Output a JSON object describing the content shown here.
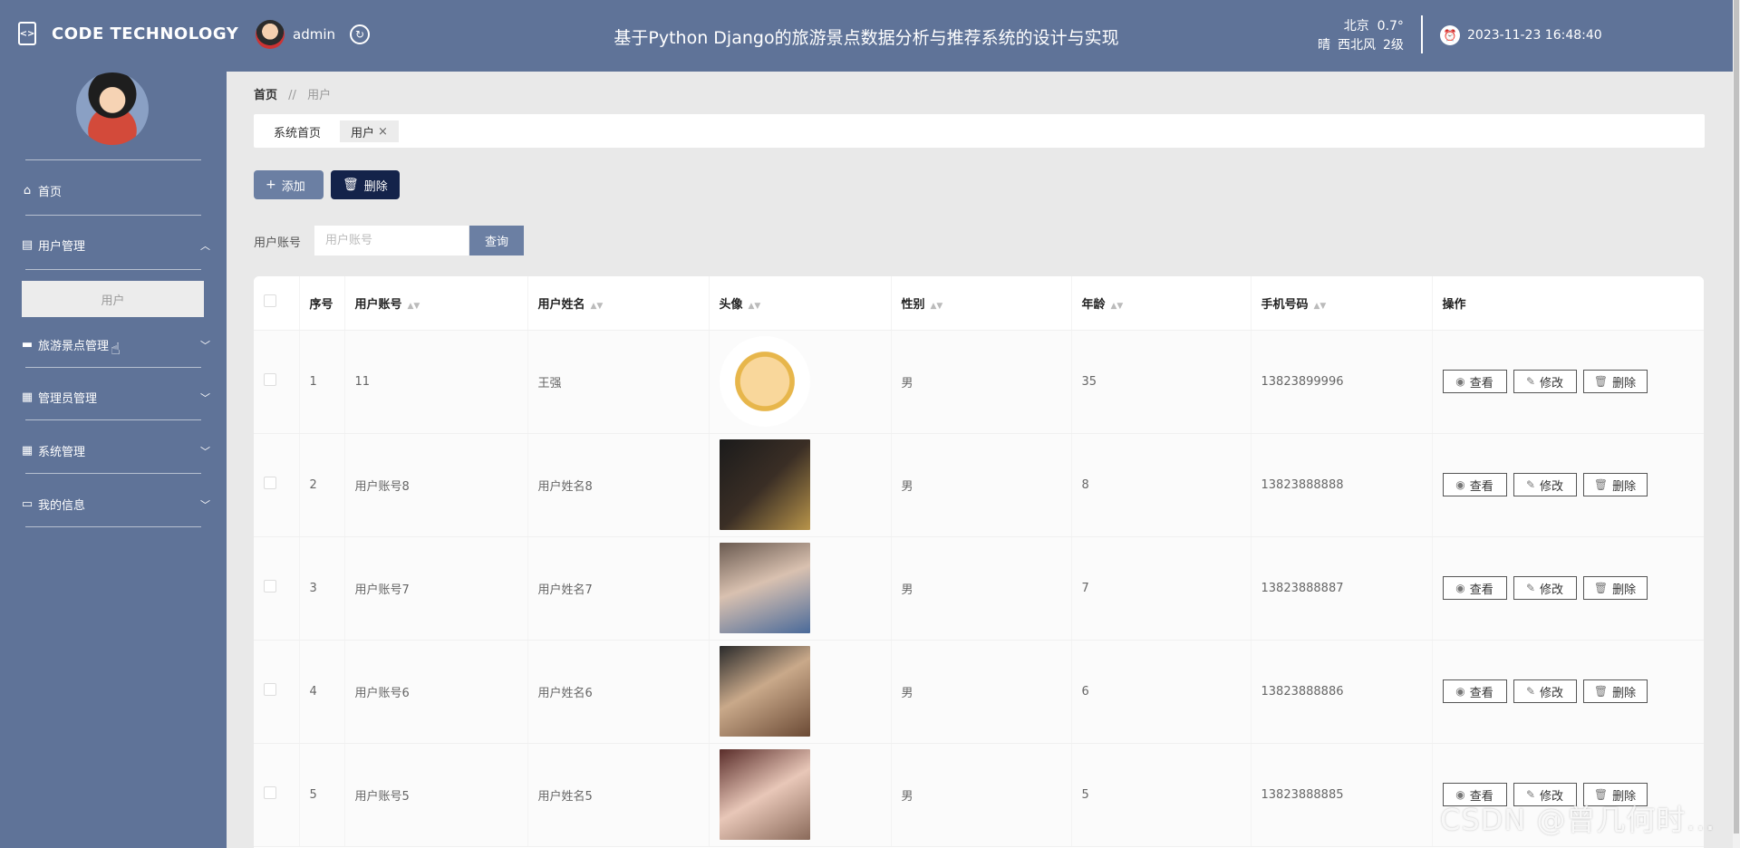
{
  "header": {
    "brand": "CODE TECHNOLOGY",
    "brand_icon": "code-file-icon",
    "user_name": "admin",
    "title": "基于Python Django的旅游景点数据分析与推荐系统的设计与实现",
    "weather_city": "北京",
    "weather_temp": "0.7°",
    "weather_cond": "晴",
    "weather_wind": "西北风",
    "weather_level": "2级",
    "datetime": "2023-11-23 16:48:40",
    "bg_color": "#5f7398"
  },
  "sidebar": {
    "items": [
      {
        "label": "首页",
        "icon": "home-icon"
      },
      {
        "label": "用户管理",
        "icon": "clipboard-icon",
        "expanded": true
      },
      {
        "label": "旅游景点管理",
        "icon": "briefcase-icon"
      },
      {
        "label": "管理员管理",
        "icon": "grid-icon"
      },
      {
        "label": "系统管理",
        "icon": "grid-icon"
      },
      {
        "label": "我的信息",
        "icon": "card-icon"
      }
    ],
    "sub_item": "用户"
  },
  "breadcrumb": {
    "home": "首页",
    "sep": "//",
    "current": "用户"
  },
  "tabs": [
    {
      "label": "系统首页"
    },
    {
      "label": "用户",
      "close": "×"
    }
  ],
  "toolbar": {
    "add_label": "添加",
    "delete_label": "删除"
  },
  "search": {
    "label": "用户账号",
    "placeholder": "用户账号",
    "button": "查询"
  },
  "table": {
    "headers": [
      "序号",
      "用户账号",
      "用户姓名",
      "头像",
      "性别",
      "年龄",
      "手机号码",
      "操作"
    ],
    "rows": [
      {
        "no": "1",
        "account": "11",
        "name": "王强",
        "gender": "男",
        "age": "35",
        "phone": "13823899996"
      },
      {
        "no": "2",
        "account": "用户账号8",
        "name": "用户姓名8",
        "gender": "男",
        "age": "8",
        "phone": "13823888888"
      },
      {
        "no": "3",
        "account": "用户账号7",
        "name": "用户姓名7",
        "gender": "男",
        "age": "7",
        "phone": "13823888887"
      },
      {
        "no": "4",
        "account": "用户账号6",
        "name": "用户姓名6",
        "gender": "男",
        "age": "6",
        "phone": "13823888886"
      },
      {
        "no": "5",
        "account": "用户账号5",
        "name": "用户姓名5",
        "gender": "男",
        "age": "5",
        "phone": "13823888885"
      }
    ],
    "ops": {
      "view": "查看",
      "edit": "修改",
      "delete": "删除"
    }
  },
  "watermark": "CSDN @曾几何时…"
}
